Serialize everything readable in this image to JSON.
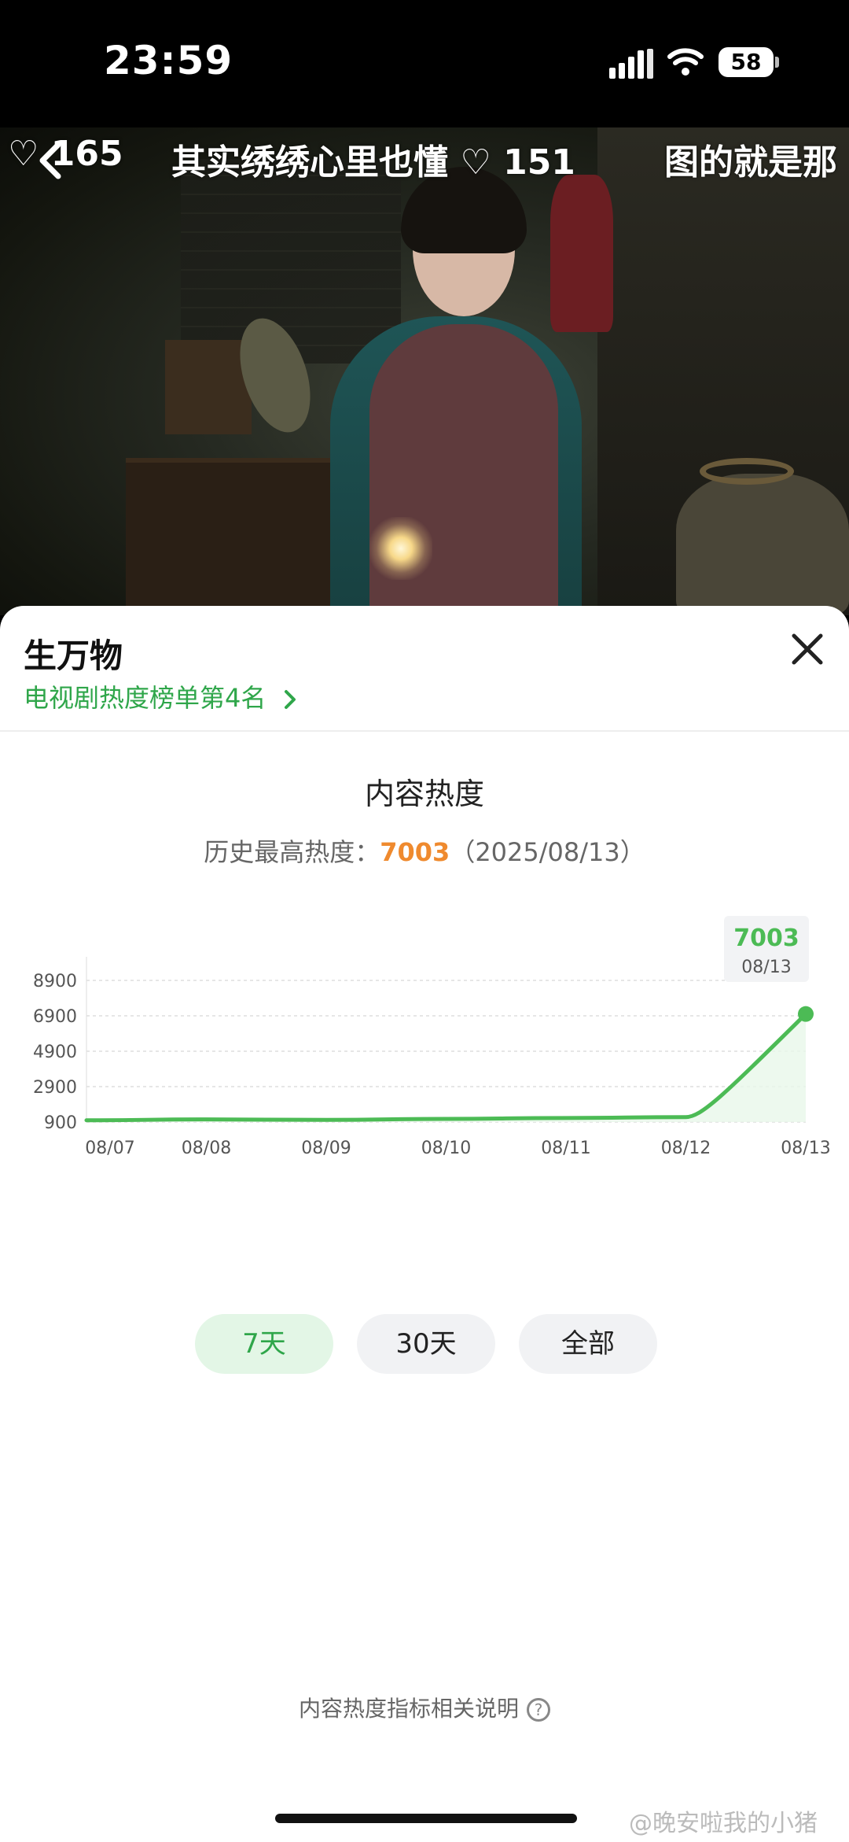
{
  "status_bar": {
    "time": "23:59",
    "battery": "58"
  },
  "video": {
    "danmaku": [
      {
        "text": "♡ 165"
      },
      {
        "text": "其实绣绣心里也懂 ♡ 151"
      },
      {
        "text": "图的就是那"
      }
    ]
  },
  "sheet": {
    "title": "生万物",
    "rank_link": "电视剧热度榜单第4名",
    "section_title": "内容热度",
    "peak_label": "历史最高热度：",
    "peak_value": "7003",
    "peak_date": "（2025/08/13）",
    "range_buttons": [
      "7天",
      "30天",
      "全部"
    ],
    "footnote": "内容热度指标相关说明",
    "watermark": "@晚安啦我的小猪"
  },
  "chart_data": {
    "type": "line",
    "x": [
      "08/07",
      "08/08",
      "08/09",
      "08/10",
      "08/11",
      "08/12",
      "08/13"
    ],
    "values": [
      1000,
      1050,
      1020,
      1080,
      1130,
      1180,
      7003
    ],
    "yticks": [
      900,
      2900,
      4900,
      6900,
      8900
    ],
    "ylim": [
      900,
      8900
    ],
    "tooltip": {
      "value": "7003",
      "date": "08/13"
    },
    "colors": {
      "line": "#4cbb55",
      "fill": "#e8f7ea",
      "grid": "#dddddd",
      "axis": "#555555"
    }
  }
}
